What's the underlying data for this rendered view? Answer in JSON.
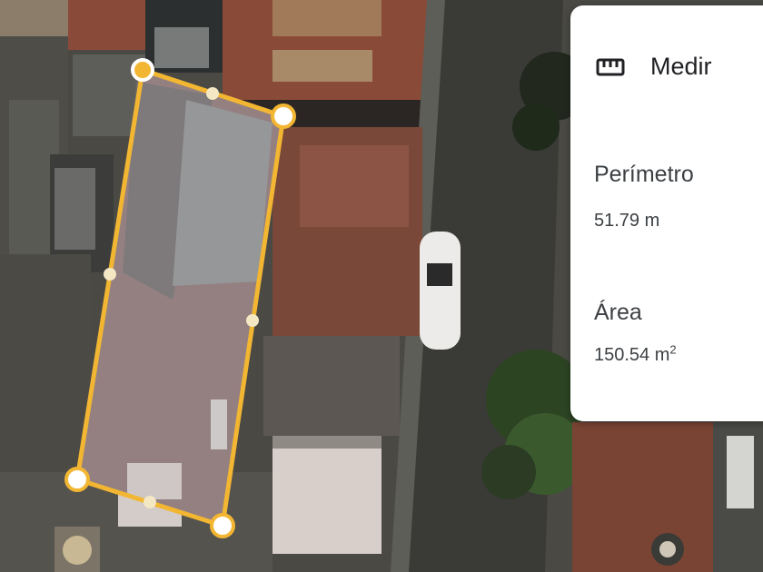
{
  "panel": {
    "title": "Medir",
    "icon": "ruler-icon",
    "perimeter_label": "Perímetro",
    "perimeter_value": "51.79 m",
    "area_label": "Área",
    "area_value": "150.54 m",
    "area_unit_exponent": "2"
  },
  "map": {
    "polygon_color": "#f2b632",
    "handle_fill": "#ffffff",
    "first_vertex_color": "#f2b632"
  }
}
